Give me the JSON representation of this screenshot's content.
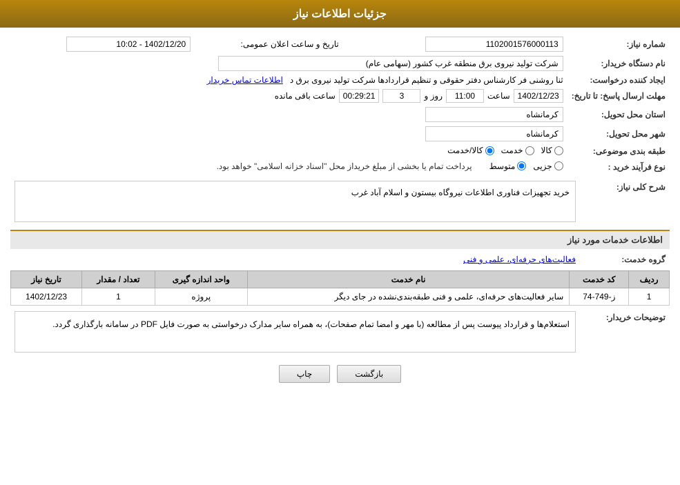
{
  "header": {
    "title": "جزئیات اطلاعات نیاز"
  },
  "fields": {
    "shomareNiaz_label": "شماره نیاز:",
    "shomareNiaz_value": "1102001576000113",
    "namDastgah_label": "نام دستگاه خریدار:",
    "namDastgah_value": "شرکت تولید نیروی برق منطقه غرب کشور (سهامی عام)",
    "ijadKonande_label": "ایجاد کننده درخواست:",
    "ijadKonande_value": "ثنا روشنی فر کارشناس دفتر حقوقی و تنظیم قراردادها شرکت تولید نیروی برق د",
    "ijadKonande_link": "اطلاعات تماس خریدار",
    "mohlat_label": "مهلت ارسال پاسخ: تا تاریخ:",
    "mohlat_date": "1402/12/23",
    "mohlat_saat_label": "ساعت",
    "mohlat_saat": "11:00",
    "mohlat_rooz_label": "روز و",
    "mohlat_rooz": "3",
    "mohlat_baqi_label": "ساعت باقی مانده",
    "mohlat_baqi": "00:29:21",
    "tarikh_label": "تاریخ و ساعت اعلان عمومی:",
    "tarikh_value": "1402/12/20 - 10:02",
    "ostan_label": "استان محل تحویل:",
    "ostan_value": "کرمانشاه",
    "shahr_label": "شهر محل تحویل:",
    "shahr_value": "کرمانشاه",
    "tabaqe_label": "طبقه بندی موضوعی:",
    "tabaqe_kala": "کالا",
    "tabaqe_khadamat": "خدمت",
    "tabaqe_kala_khadamat": "کالا/خدمت",
    "noeFarayand_label": "نوع فرآیند خرید :",
    "noeFarayand_jazii": "جزیی",
    "noeFarayand_motavaset": "متوسط",
    "noeFarayand_note": "پرداخت تمام یا بخشی از مبلغ خریداز محل \"اسناد خزانه اسلامی\" خواهد بود.",
    "sharhKoli_label": "شرح کلی نیاز:",
    "sharhKoli_value": "خرید تجهیزات فناوری اطلاعات نیروگاه بیستون و اسلام آباد غرب",
    "khadamatInfo_title": "اطلاعات خدمات مورد نیاز",
    "gerohKhadamat_label": "گروه خدمت:",
    "gerohKhadamat_value": "فعالیت‌های حرفه‌ای، علمی و فنی",
    "table": {
      "headers": [
        "ردیف",
        "کد خدمت",
        "نام خدمت",
        "واحد اندازه گیری",
        "تعداد / مقدار",
        "تاریخ نیاز"
      ],
      "rows": [
        {
          "radif": "1",
          "kodKhadamat": "ز-749-74",
          "namKhadamat": "سایر فعالیت‌های حرفه‌ای، علمی و فنی طبقه‌بندی‌نشده در جای دیگر",
          "vahed": "پروژه",
          "tedad": "1",
          "tarikh": "1402/12/23"
        }
      ]
    },
    "tawzihKharidar_label": "توضیحات خریدار:",
    "tawzihKharidar_value": "استعلام‌ها و قرارداد پیوست پس از مطالعه (با مهر و امضا تمام صفحات)، به همراه سایر مدارک درخواستی به صورت فایل PDF در سامانه بارگذاری گردد.",
    "btn_print": "چاپ",
    "btn_back": "بازگشت"
  }
}
